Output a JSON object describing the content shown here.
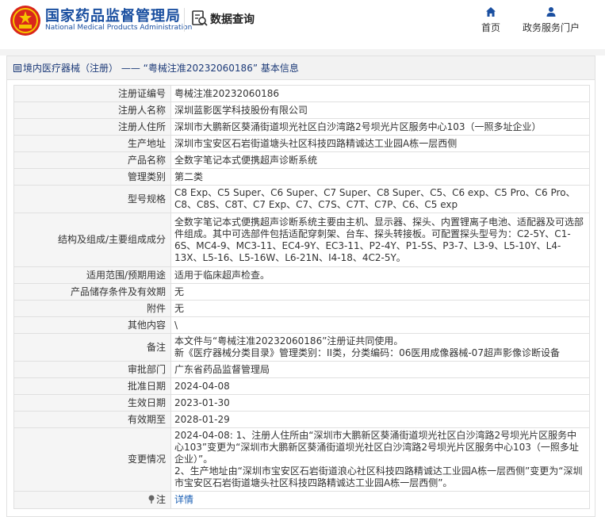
{
  "header": {
    "brand_cn": "国家药品监督管理局",
    "brand_en": "National Medical Products Administration",
    "search_label": "数据查询",
    "nav": {
      "home": "首页",
      "gov": "政务服务门户"
    },
    "brand_color": "#1a4fa0",
    "icons": {
      "logo": "national-emblem",
      "search": "search-data-icon",
      "home": "home-icon",
      "gov": "user-icon"
    }
  },
  "panel": {
    "title": "境内医疗器械（注册） —— “粤械注准20232060186” 基本信息"
  },
  "rows": [
    {
      "label": "注册证编号",
      "value": "粤械注准20232060186"
    },
    {
      "label": "注册人名称",
      "value": "深圳蓝影医学科技股份有限公司"
    },
    {
      "label": "注册人住所",
      "value": "深圳市大鹏新区葵涌街道坝光社区白沙湾路2号坝光片区服务中心103（一照多址企业）"
    },
    {
      "label": "生产地址",
      "value": "深圳市宝安区石岩街道塘头社区科技四路精诚达工业园A栋一层西侧"
    },
    {
      "label": "产品名称",
      "value": "全数字笔记本式便携超声诊断系统"
    },
    {
      "label": "管理类别",
      "value": "第二类"
    },
    {
      "label": "型号规格",
      "value": "C8 Exp、C5 Super、C6 Super、C7 Super、C8 Super、C5、C6 exp、C5 Pro、C6 Pro、C8、C8S、C8T、C7 Exp、C7、C7S、C7T、C7P、C6、C5 exp"
    },
    {
      "label": "结构及组成/主要组成成分",
      "value": "全数字笔记本式便携超声诊断系统主要由主机、显示器、探头、内置锂离子电池、适配器及可选部件组成。其中可选部件包括适配穿刺架、台车、探头转接板。可配置探头型号为：C2-5Y、C1-6S、MC4-9、MC3-11、EC4-9Y、EC3-11、P2-4Y、P1-5S、P3-7、L3-9、L5-10Y、L4-13X、L5-16、L5-16W、L6-21N、I4-18、4C2-5Y。"
    },
    {
      "label": "适用范围/预期用途",
      "value": "适用于临床超声检查。"
    },
    {
      "label": "产品储存条件及有效期",
      "value": "无"
    },
    {
      "label": "附件",
      "value": "无"
    },
    {
      "label": "其他内容",
      "value": "\\"
    },
    {
      "label": "备注",
      "value": "本文件与“粤械注准20232060186”注册证共同使用。\n新《医疗器械分类目录》管理类别：II类，分类编码：06医用成像器械-07超声影像诊断设备"
    },
    {
      "label": "审批部门",
      "value": "广东省药品监督管理局"
    },
    {
      "label": "批准日期",
      "value": "2024-04-08"
    },
    {
      "label": "生效日期",
      "value": "2023-01-30"
    },
    {
      "label": "有效期至",
      "value": "2028-01-29"
    },
    {
      "label": "变更情况",
      "value": "2024-04-08: 1、注册人住所由“深圳市大鹏新区葵涌街道坝光社区白沙湾路2号坝光片区服务中心103”变更为“深圳市大鹏新区葵涌街道坝光社区白沙湾路2号坝光片区服务中心103（一照多址企业）”。\n2、生产地址由“深圳市宝安区石岩街道浪心社区科技四路精诚达工业园A栋一层西侧”变更为“深圳市宝安区石岩街道塘头社区科技四路精诚达工业园A栋一层西侧”。"
    }
  ],
  "note": {
    "label": "注",
    "link": "详情",
    "icon": "pin-icon"
  }
}
